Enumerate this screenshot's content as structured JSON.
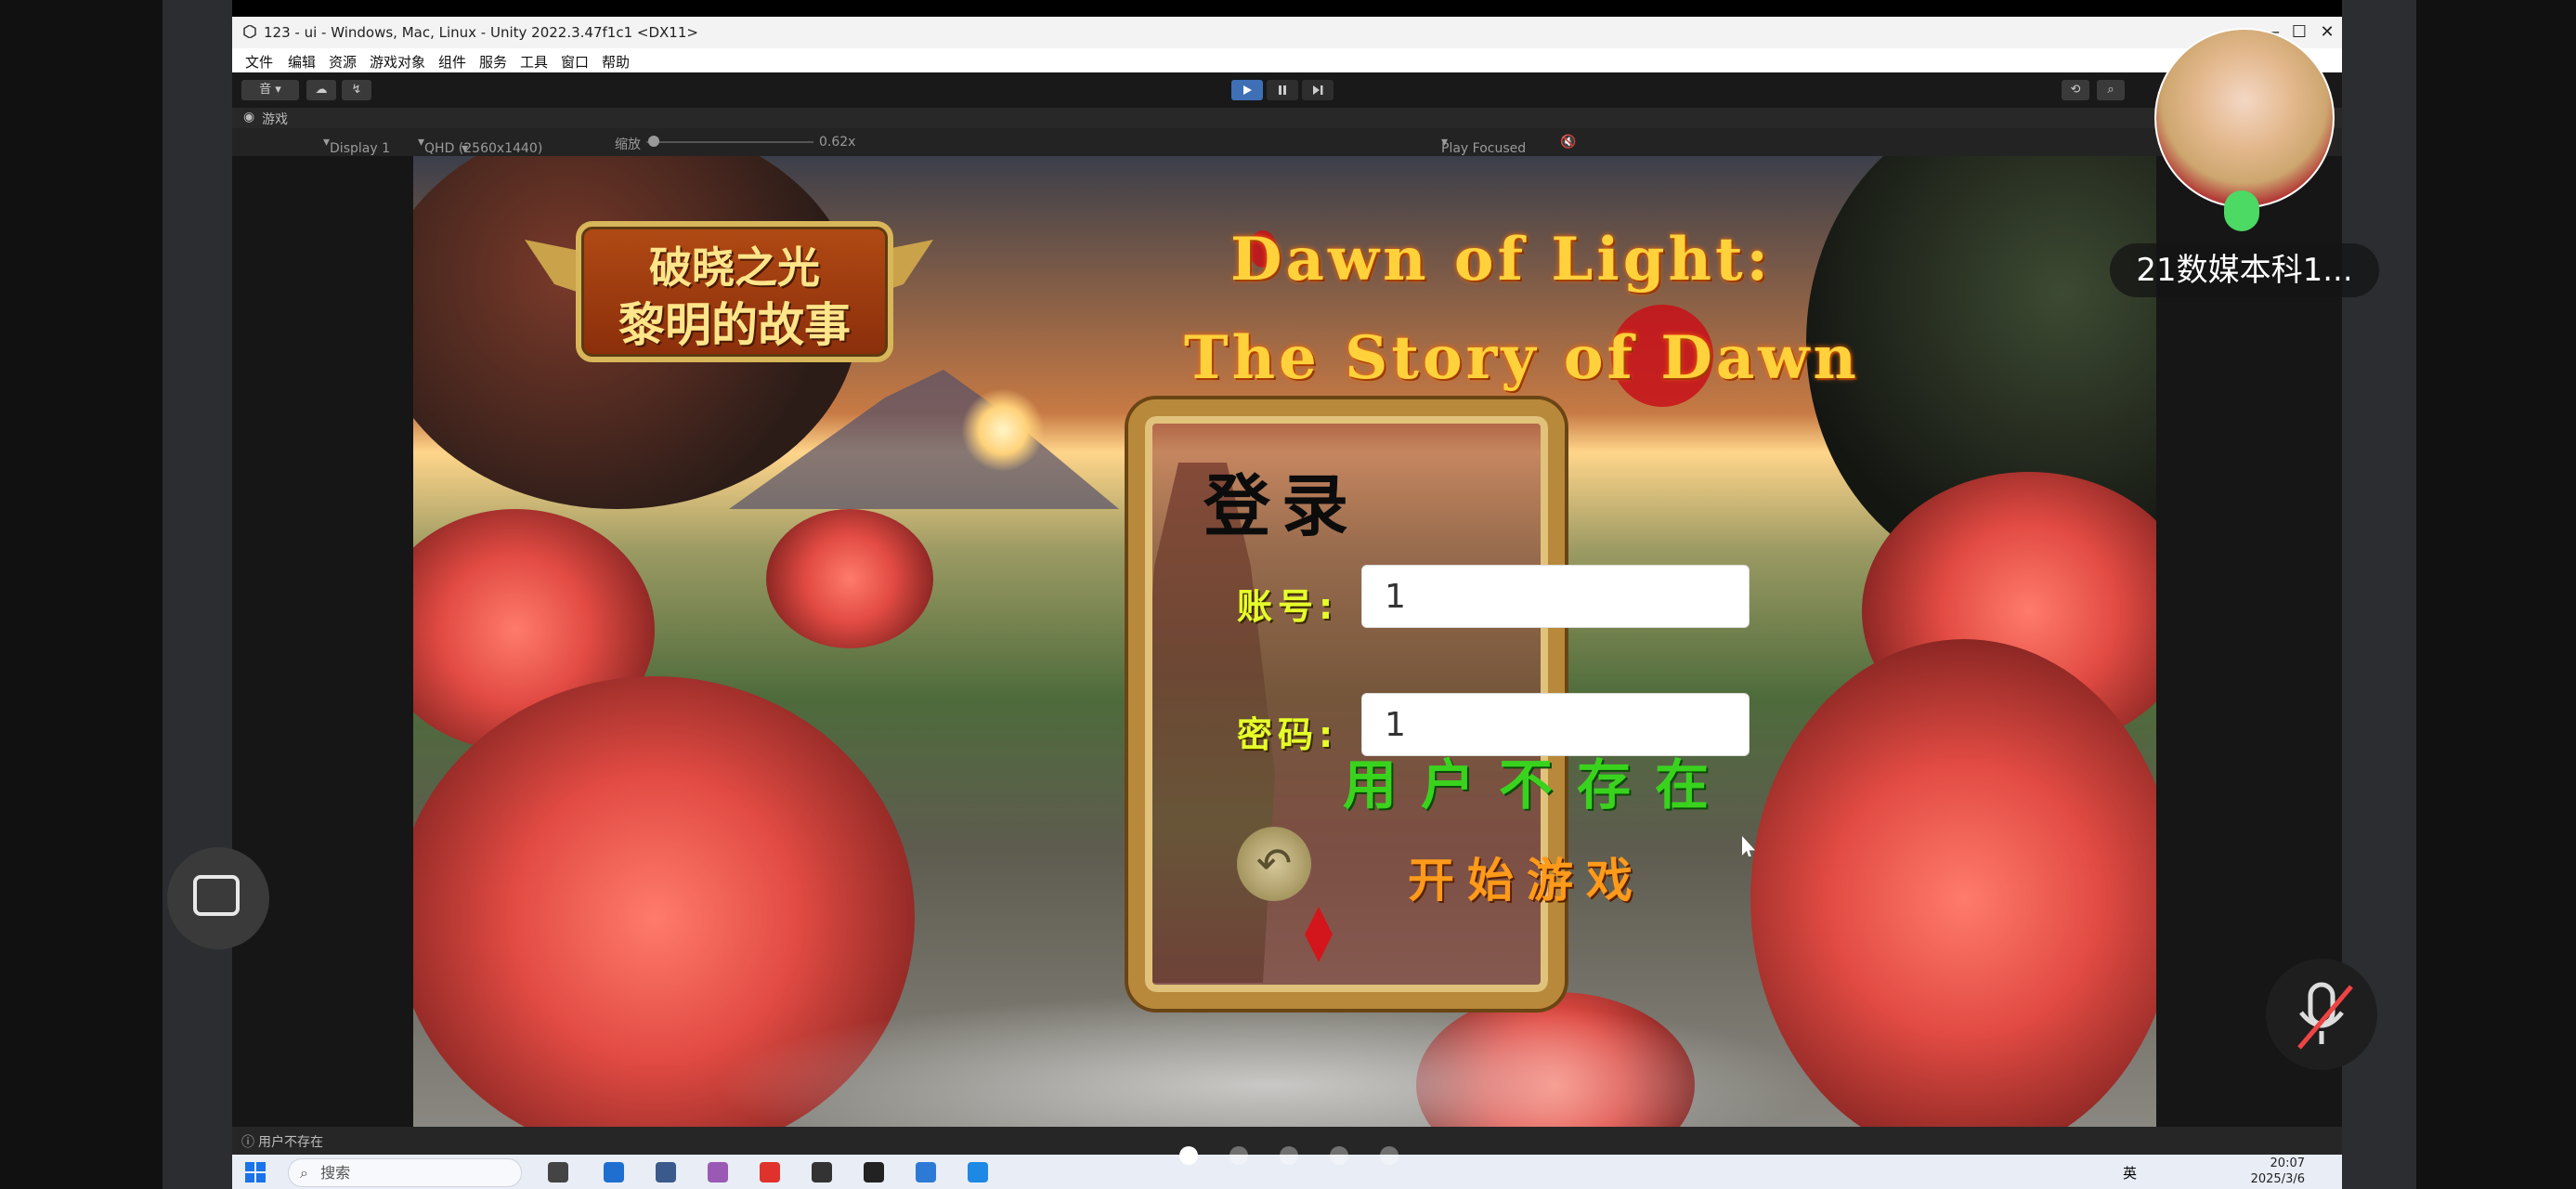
{
  "window": {
    "title": "123 - ui - Windows, Mac, Linux - Unity 2022.3.47f1c1 <DX11>",
    "minimize": "—",
    "maximize": "☐",
    "close": "✕"
  },
  "menu": [
    "文件",
    "编辑",
    "资源",
    "游戏对象",
    "组件",
    "服务",
    "工具",
    "窗口",
    "帮助"
  ],
  "toolbar": {
    "account_label": "音 ▾",
    "play_icon": "play-icon",
    "pause_icon": "pause-icon",
    "step_icon": "step-icon"
  },
  "game_tab": {
    "label": "游戏"
  },
  "game_bar": {
    "display": "Display 1",
    "resolution": "QHD (2560x1440)",
    "scale_label": "缩放",
    "scale_value": "0.62x",
    "play_mode": "Play Focused"
  },
  "game": {
    "logo_line1": "破晓之光",
    "logo_line2": "黎明的故事",
    "title_line1": "Dawn of Light:",
    "title_line2": "The Story of Dawn",
    "login_title": "登录",
    "account_label": "账号:",
    "account_value": "1",
    "password_label": "密码:",
    "password_value": "1",
    "message": "用户不存在",
    "back_icon": "↶",
    "start_label": "开始游戏"
  },
  "status_bar": {
    "message": "用户不存在"
  },
  "taskbar": {
    "search_placeholder": "搜索",
    "time": "20:07",
    "date": "2025/3/6",
    "lang": "英"
  },
  "meeting": {
    "participant_name": "21数媒本科1..."
  },
  "colors": {
    "title_gold": "#ffd23b",
    "label_yellow": "#e6ff2a",
    "message_green": "#39d31e",
    "start_orange": "#ff9a1a",
    "mic_green": "#4cd964"
  }
}
